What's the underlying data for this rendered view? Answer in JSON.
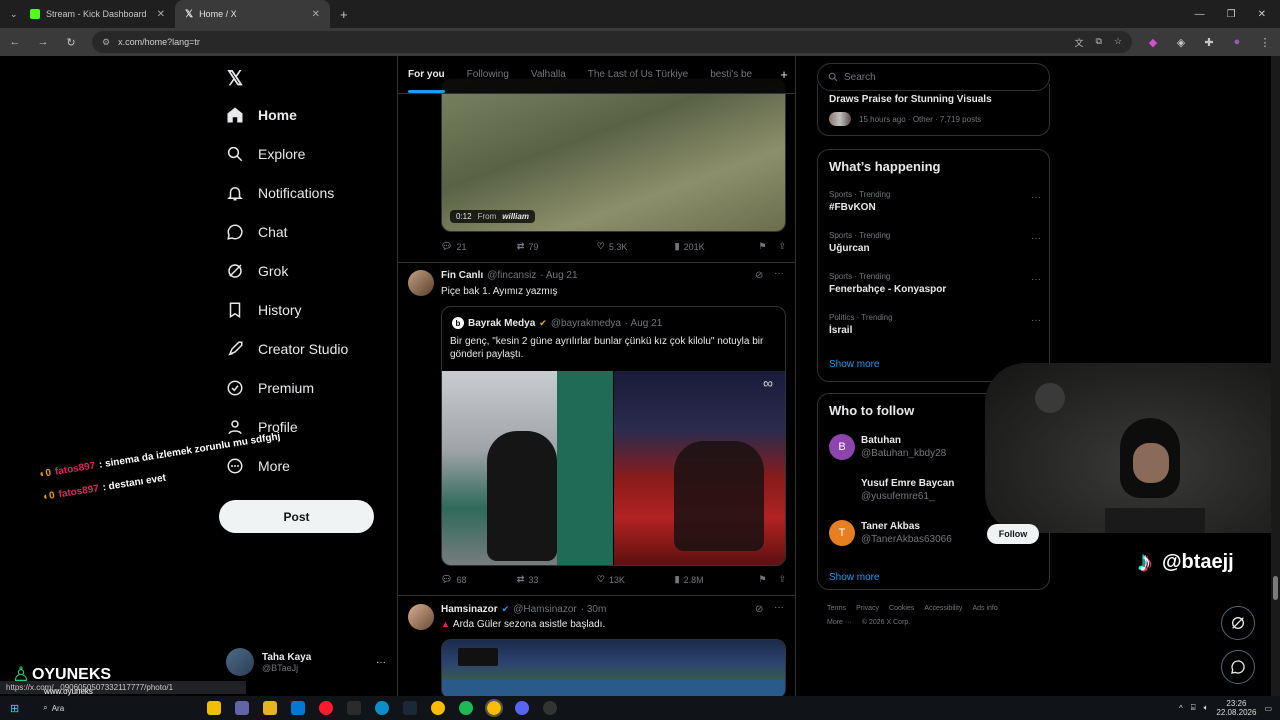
{
  "browser": {
    "tabs": [
      {
        "title": "Stream - Kick Dashboard",
        "favicon_color": "#53fc18"
      },
      {
        "title": "Home / X"
      }
    ],
    "url": "x.com/home?lang=tr",
    "status_url": "https://x.com/...0906050507332117777/photo/1"
  },
  "nav": {
    "items": [
      {
        "label": "Home",
        "icon": "home-icon"
      },
      {
        "label": "Explore",
        "icon": "search-icon"
      },
      {
        "label": "Notifications",
        "icon": "bell-icon"
      },
      {
        "label": "Chat",
        "icon": "chat-icon"
      },
      {
        "label": "Grok",
        "icon": "grok-icon"
      },
      {
        "label": "History",
        "icon": "bookmark-icon"
      },
      {
        "label": "Creator Studio",
        "icon": "rocket-icon"
      },
      {
        "label": "Premium",
        "icon": "premium-icon"
      },
      {
        "label": "Profile",
        "icon": "person-icon"
      },
      {
        "label": "More",
        "icon": "more-icon"
      }
    ],
    "post_label": "Post",
    "account": {
      "name": "Taha Kaya",
      "handle": "@BTaeJj"
    }
  },
  "feed": {
    "tabs": [
      "For you",
      "Following",
      "Valhalla",
      "The Last of Us Türkiye",
      "besti's be"
    ],
    "tweet1": {
      "video_time": "0:12",
      "video_from": "From",
      "video_source": "william",
      "replies": "21",
      "reposts": "79",
      "likes": "5.3K",
      "views": "201K"
    },
    "tweet2": {
      "name": "Fin Canlı",
      "handle": "@fincansiz",
      "date": "· Aug 21",
      "text": "Piçe bak 1. Ayımız yazmış",
      "quote": {
        "name": "Bayrak Medya",
        "handle": "@bayrakmedya",
        "date": "· Aug 21",
        "text": "Bir genç, \"kesin 2 güne ayrılırlar bunlar çünkü kız çok kilolu\" notuyla bir gönderi paylaştı."
      },
      "replies": "68",
      "reposts": "33",
      "likes": "13K",
      "views": "2.8M"
    },
    "tweet3": {
      "name": "Hamsinazor",
      "handle": "@Hamsinazor",
      "date": "· 30m",
      "text": "Arda Güler sezona asistle başladı."
    }
  },
  "right": {
    "search_placeholder": "Search",
    "top_card": {
      "title": "Draws Praise for Stunning Visuals",
      "meta": "15 hours ago · Other · 7,719 posts"
    },
    "happening": {
      "title": "What’s happening",
      "trends": [
        {
          "cat": "Sports · Trending",
          "name": "#FBvKON"
        },
        {
          "cat": "Sports · Trending",
          "name": "Uğurcan"
        },
        {
          "cat": "Sports · Trending",
          "name": "Fenerbahçe - Konyaspor"
        },
        {
          "cat": "Politics · Trending",
          "name": "İsrail"
        }
      ],
      "show_more": "Show more"
    },
    "who_to_follow": {
      "title": "Who to follow",
      "users": [
        {
          "name": "Batuhan",
          "handle": "@Batuhan_kbdy28",
          "initial": "B",
          "color": "#8e44ad"
        },
        {
          "name": "Yusuf Emre Baycan",
          "handle": "@yusufemre61_",
          "initial": "",
          "color": "#000000"
        },
        {
          "name": "Taner Akbas",
          "handle": "@TanerAkbas63066",
          "initial": "T",
          "color": "#e67e22"
        }
      ],
      "follow_label": "Follow",
      "show_more": "Show more"
    },
    "footer": [
      "Terms",
      "Privacy",
      "Cookies",
      "Accessibility",
      "Ads info",
      "More ···",
      "© 2026 X Corp."
    ]
  },
  "overlay": {
    "chat_lines": [
      {
        "user": "fatos897",
        "text": ": sinema da izlemek zorunlu mu sdfghj"
      },
      {
        "user": "fatos897",
        "text": ": destanı evet"
      }
    ],
    "tiktok_handle": "@btaejj",
    "brand": "OYUNEKS",
    "brand_url": "www.oyuneks"
  },
  "taskbar": {
    "search": "Ara",
    "time": "23:26",
    "date": "22.08.2026"
  }
}
